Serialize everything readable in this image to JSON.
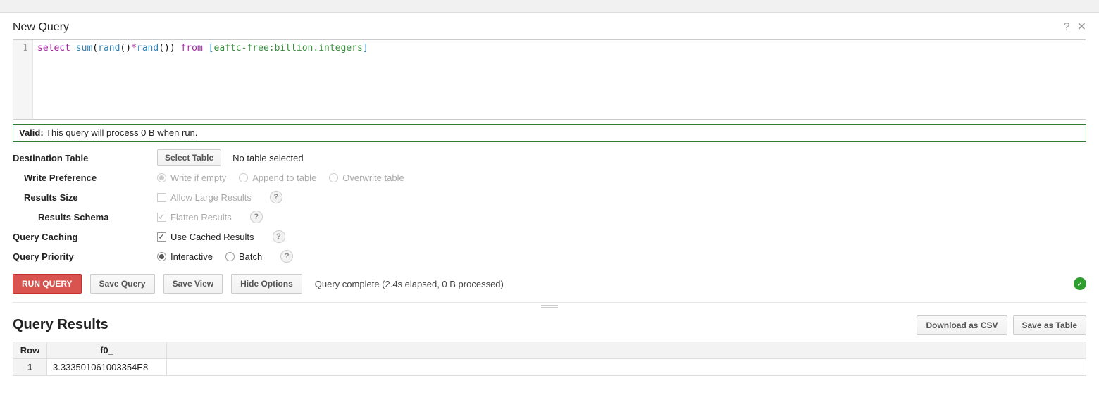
{
  "header": {
    "title": "New Query"
  },
  "editor": {
    "line_number": "1",
    "tok_select": "select",
    "tok_sum": "sum",
    "tok_lp1": "(",
    "tok_rand1": "rand",
    "tok_lp2": "(",
    "tok_rp2": ")",
    "tok_star": "*",
    "tok_rand2": "rand",
    "tok_lp3": "(",
    "tok_rp3": ")",
    "tok_rp1": ")",
    "tok_from": "from",
    "tok_lbrack": "[",
    "tok_table": "eaftc-free:billion.integers",
    "tok_rbrack": "]"
  },
  "validation": {
    "prefix": "Valid:",
    "message": "This query will process 0 B when run."
  },
  "options": {
    "dest_table_label": "Destination Table",
    "select_table_btn": "Select Table",
    "no_table_selected": "No table selected",
    "write_pref_label": "Write Preference",
    "write_if_empty": "Write if empty",
    "append": "Append to table",
    "overwrite": "Overwrite table",
    "results_size_label": "Results Size",
    "allow_large": "Allow Large Results",
    "results_schema_label": "Results Schema",
    "flatten": "Flatten Results",
    "caching_label": "Query Caching",
    "use_cached": "Use Cached Results",
    "priority_label": "Query Priority",
    "interactive": "Interactive",
    "batch": "Batch"
  },
  "actions": {
    "run": "RUN QUERY",
    "save_query": "Save Query",
    "save_view": "Save View",
    "hide_options": "Hide Options",
    "status": "Query complete (2.4s elapsed, 0 B processed)"
  },
  "results": {
    "title": "Query Results",
    "download_csv": "Download as CSV",
    "save_table": "Save as Table",
    "columns": [
      "Row",
      "f0_"
    ],
    "rows": [
      {
        "row": "1",
        "f0_": "3.333501061003354E8"
      }
    ]
  }
}
